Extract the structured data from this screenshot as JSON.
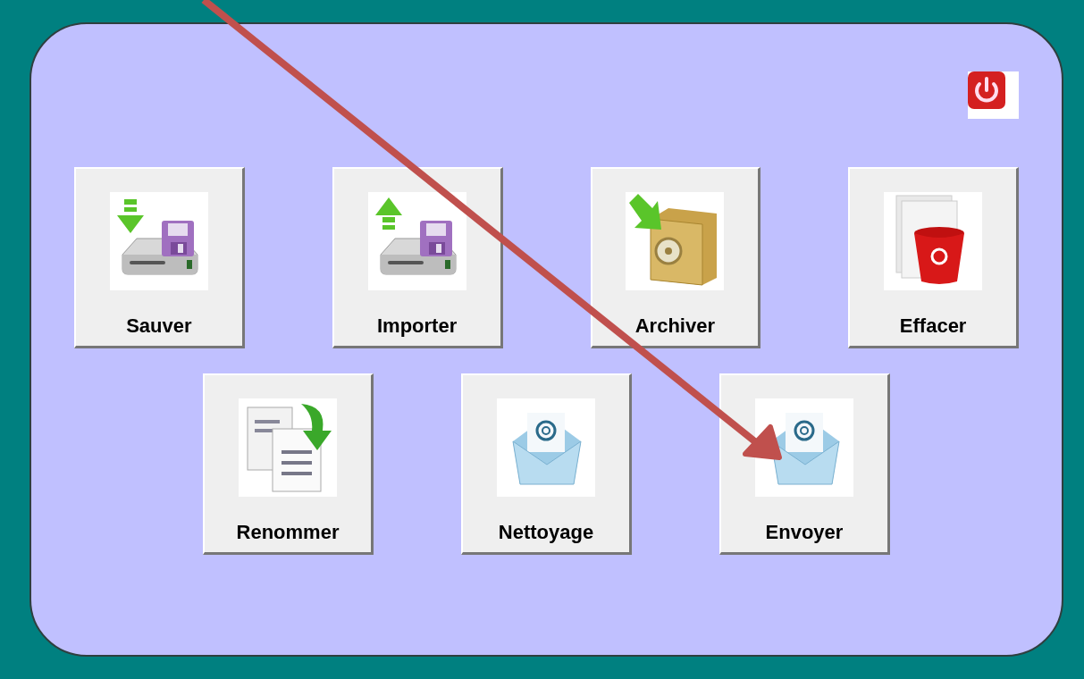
{
  "rows": [
    [
      {
        "label": "Sauver",
        "kind": "save"
      },
      {
        "label": "Importer",
        "kind": "import"
      },
      {
        "label": "Archiver",
        "kind": "archive"
      },
      {
        "label": "Effacer",
        "kind": "delete"
      }
    ],
    [
      {
        "label": "Renommer",
        "kind": "rename"
      },
      {
        "label": "Nettoyage",
        "kind": "mail"
      },
      {
        "label": "Envoyer",
        "kind": "mail"
      }
    ]
  ]
}
